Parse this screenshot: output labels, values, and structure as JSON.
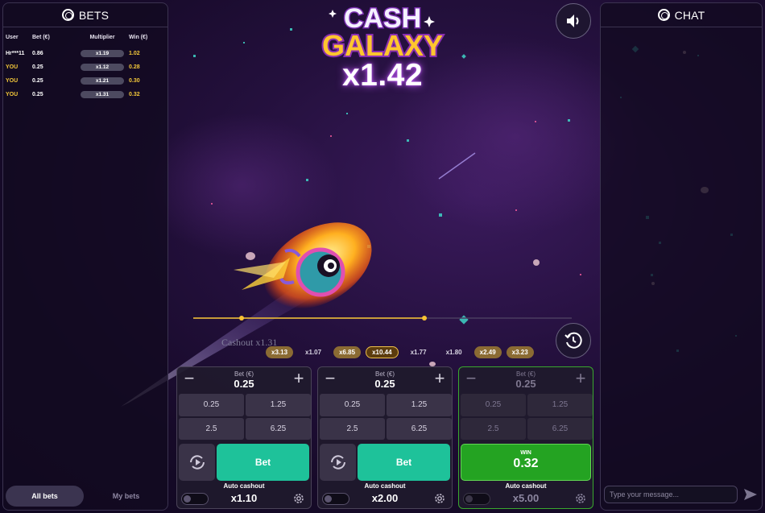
{
  "bets_panel": {
    "title": "BETS",
    "columns": [
      "User",
      "Bet (€)",
      "Multiplier",
      "Win (€)"
    ],
    "rows": [
      {
        "user": "Hr***11",
        "bet": "0.86",
        "multiplier": "x1.19",
        "win": "1.02",
        "is_you": false
      },
      {
        "user": "YOU",
        "bet": "0.25",
        "multiplier": "x1.12",
        "win": "0.28",
        "is_you": true
      },
      {
        "user": "YOU",
        "bet": "0.25",
        "multiplier": "x1.21",
        "win": "0.30",
        "is_you": true
      },
      {
        "user": "YOU",
        "bet": "0.25",
        "multiplier": "x1.31",
        "win": "0.32",
        "is_you": true
      }
    ],
    "tabs": {
      "all_bets": "All bets",
      "my_bets": "My bets"
    }
  },
  "chat_panel": {
    "title": "CHAT",
    "placeholder": "Type your message..."
  },
  "game": {
    "logo_line1": "CASH",
    "logo_line2": "GALAXY",
    "multiplier": "x1.42",
    "cashout_float": "Cashout x1.31",
    "history": [
      {
        "value": "x3.13",
        "style": "hi"
      },
      {
        "value": "x1.07",
        "style": "lo"
      },
      {
        "value": "x6.85",
        "style": "hi"
      },
      {
        "value": "x10.44",
        "style": "top"
      },
      {
        "value": "x1.77",
        "style": "lo"
      },
      {
        "value": "x1.80",
        "style": "lo"
      },
      {
        "value": "x2.49",
        "style": "hi"
      },
      {
        "value": "x3.23",
        "style": "hi"
      }
    ]
  },
  "bet_cards": [
    {
      "bet_label": "Bet (€)",
      "bet_value": "0.25",
      "presets": [
        "0.25",
        "1.25",
        "2.5",
        "6.25"
      ],
      "action_label": "Bet",
      "auto_cashout_label": "Auto cashout",
      "auto_cashout_value": "x1.10"
    },
    {
      "bet_label": "Bet (€)",
      "bet_value": "0.25",
      "presets": [
        "0.25",
        "1.25",
        "2.5",
        "6.25"
      ],
      "action_label": "Bet",
      "auto_cashout_label": "Auto cashout",
      "auto_cashout_value": "x2.00"
    },
    {
      "bet_label": "Bet (€)",
      "bet_value": "0.25",
      "presets": [
        "0.25",
        "1.25",
        "2.5",
        "6.25"
      ],
      "win_label": "WIN",
      "win_amount": "0.32",
      "auto_cashout_label": "Auto cashout",
      "auto_cashout_value": "x5.00"
    }
  ],
  "colors": {
    "accent_teal": "#1ec29a",
    "win_green": "#24a322",
    "gold": "#f4c83a",
    "multiplier_glow": "#c15bff"
  },
  "icons": {
    "sound": "speaker-icon",
    "history": "history-clock-icon",
    "auto_play": "auto-play-icon",
    "settings": "gear-icon",
    "send": "send-icon"
  }
}
